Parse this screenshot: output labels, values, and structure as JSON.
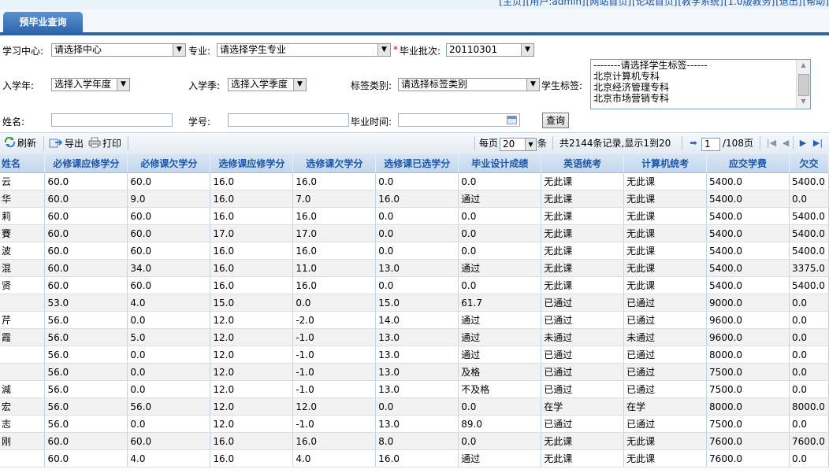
{
  "top_links": [
    "[主页]",
    "[用户:admin]",
    "[网站首页]",
    "[论坛首页]",
    "[教学系统]",
    "[1.0版教务]",
    "[退出]",
    "[帮助]"
  ],
  "tab": {
    "label": "预毕业查询"
  },
  "filters": {
    "center_label": "学习中心:",
    "center_value": "请选择中心",
    "major_label": "专业:",
    "major_value": "请选择学生专业",
    "batch_required": "*",
    "batch_label": "毕业批次:",
    "batch_value": "20110301",
    "year_label": "入学年:",
    "year_value": "选择入学年度",
    "season_label": "入学季:",
    "season_value": "选择入学季度",
    "tagtype_label": "标签类别:",
    "tagtype_value": "请选择标签类别",
    "tag_label": "学生标签:",
    "tag_options": [
      "--------请选择学生标签------",
      "北京计算机专科",
      "北京经济管理专科",
      "北京市场营销专科"
    ],
    "name_label": "姓名:",
    "name_value": "",
    "studentno_label": "学号:",
    "studentno_value": "",
    "gradtime_label": "毕业时间:",
    "gradtime_value": "",
    "query_button": "查询"
  },
  "toolbar": {
    "refresh": "刷新",
    "export": "导出",
    "print": "打印",
    "per_page_label": "每页",
    "per_page_value": "20",
    "per_page_unit": "条",
    "summary": "共2144条记录,显示1到20",
    "page_value": "1",
    "page_total": "/108页"
  },
  "columns": [
    "姓名",
    "必修课应修学分",
    "必修课欠学分",
    "选修课应修学分",
    "选修课欠学分",
    "选修课已选学分",
    "毕业设计成绩",
    "英语统考",
    "计算机统考",
    "应交学费",
    "欠交"
  ],
  "rows": [
    [
      "云",
      "60.0",
      "60.0",
      "16.0",
      "16.0",
      "0.0",
      "0.0",
      "无此课",
      "无此课",
      "5400.0",
      "5400.0"
    ],
    [
      "华",
      "60.0",
      "9.0",
      "16.0",
      "7.0",
      "16.0",
      "通过",
      "无此课",
      "无此课",
      "5400.0",
      "0.0"
    ],
    [
      "莉",
      "60.0",
      "60.0",
      "16.0",
      "16.0",
      "0.0",
      "0.0",
      "无此课",
      "无此课",
      "5400.0",
      "5400.0"
    ],
    [
      "賽",
      "60.0",
      "60.0",
      "17.0",
      "17.0",
      "0.0",
      "0.0",
      "无此课",
      "无此课",
      "5400.0",
      "5400.0"
    ],
    [
      "波",
      "60.0",
      "60.0",
      "16.0",
      "16.0",
      "0.0",
      "0.0",
      "无此课",
      "无此课",
      "5400.0",
      "5400.0"
    ],
    [
      "混",
      "60.0",
      "34.0",
      "16.0",
      "11.0",
      "13.0",
      "通过",
      "无此课",
      "无此课",
      "5400.0",
      "3375.0"
    ],
    [
      "贤",
      "60.0",
      "60.0",
      "16.0",
      "16.0",
      "0.0",
      "0.0",
      "无此课",
      "无此课",
      "5400.0",
      "5400.0"
    ],
    [
      "",
      "53.0",
      "4.0",
      "15.0",
      "0.0",
      "15.0",
      "61.7",
      "已通过",
      "已通过",
      "9000.0",
      "0.0"
    ],
    [
      "芹",
      "56.0",
      "0.0",
      "12.0",
      "-2.0",
      "14.0",
      "通过",
      "已通过",
      "已通过",
      "9600.0",
      "0.0"
    ],
    [
      "霞",
      "56.0",
      "5.0",
      "12.0",
      "-1.0",
      "13.0",
      "通过",
      "未通过",
      "未通过",
      "9600.0",
      "0.0"
    ],
    [
      "",
      "56.0",
      "0.0",
      "12.0",
      "-1.0",
      "13.0",
      "通过",
      "已通过",
      "已通过",
      "8000.0",
      "0.0"
    ],
    [
      "",
      "56.0",
      "0.0",
      "12.0",
      "-1.0",
      "13.0",
      "及格",
      "已通过",
      "已通过",
      "7500.0",
      "0.0"
    ],
    [
      "減",
      "56.0",
      "0.0",
      "12.0",
      "-1.0",
      "13.0",
      "不及格",
      "已通过",
      "已通过",
      "7500.0",
      "0.0"
    ],
    [
      "宏",
      "56.0",
      "56.0",
      "12.0",
      "12.0",
      "0.0",
      "0.0",
      "在学",
      "在学",
      "8000.0",
      "8000.0"
    ],
    [
      "志",
      "56.0",
      "0.0",
      "12.0",
      "-1.0",
      "13.0",
      "89.0",
      "已通过",
      "已通过",
      "7500.0",
      "0.0"
    ],
    [
      "刚",
      "60.0",
      "60.0",
      "16.0",
      "16.0",
      "8.0",
      "0.0",
      "无此课",
      "无此课",
      "7600.0",
      "7600.0"
    ],
    [
      "",
      "60.0",
      "4.0",
      "16.0",
      "4.0",
      "16.0",
      "通过",
      "无此课",
      "无此课",
      "7600.0",
      "0.0"
    ]
  ]
}
